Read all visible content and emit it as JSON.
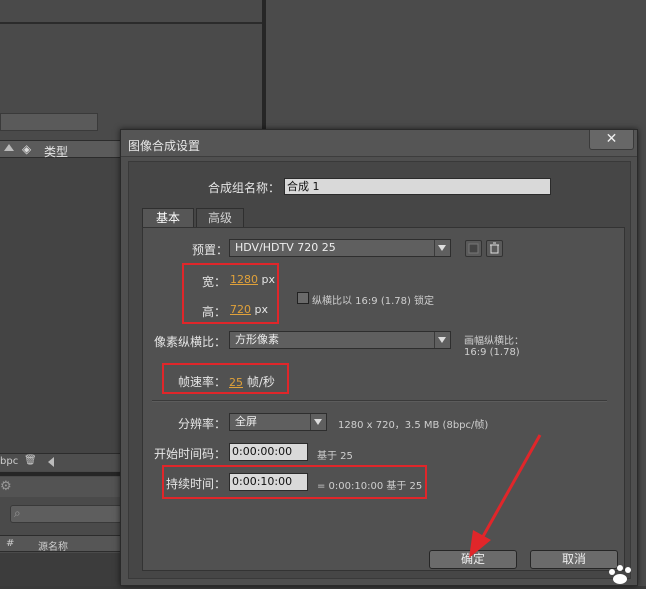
{
  "background": {
    "project_col_type": "类型",
    "toolbar_bpc": "bpc",
    "timeline_col_hash": "#",
    "timeline_col_name": "源名称"
  },
  "dialog": {
    "title": "图像合成设置",
    "close_symbol": "✕",
    "comp_name_label": "合成组名称：",
    "comp_name_value": "合成 1",
    "tabs": [
      "基本",
      "高级"
    ],
    "preset_label": "预置：",
    "preset_value": "HDV/HDTV 720 25",
    "width_label": "宽：",
    "width_value": "1280",
    "width_unit": "px",
    "height_label": "高：",
    "height_value": "720",
    "height_unit": "px",
    "lock_aspect_label": "纵横比以 16:9 (1.78) 锁定",
    "pixel_aspect_label": "像素纵横比：",
    "pixel_aspect_value": "方形像素",
    "frame_aspect_label": "画幅纵横比：",
    "frame_aspect_value": "16:9 (1.78)",
    "frame_rate_label": "帧速率：",
    "frame_rate_value": "25",
    "frame_rate_unit": "帧/秒",
    "resolution_label": "分辨率：",
    "resolution_value": "全屏",
    "resolution_info": "1280 x 720，3.5 MB (8bpc/帧)",
    "start_tc_label": "开始时间码：",
    "start_tc_value": "0:00:00:00",
    "start_tc_note": "基于 25",
    "duration_label": "持续时间：",
    "duration_value": "0:00:10:00",
    "duration_note": "= 0:00:10:00  基于 25",
    "ok_label": "确定",
    "cancel_label": "取消"
  },
  "annotation_color": "#e0262a",
  "accent_value_color": "#e0a13a"
}
